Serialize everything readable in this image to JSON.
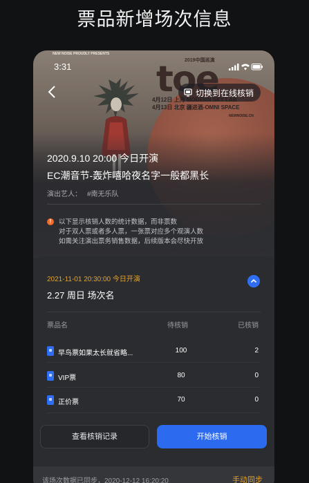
{
  "headline": "票品新增场次信息",
  "status_bar": {
    "time": "3:31"
  },
  "poster": {
    "top_text": "NEW NOISE PROUDLY PRESENTS",
    "logo": "toe",
    "year_text": "2019中国巡演",
    "lines": [
      "4月12日 上海 MODERN SKY LAB",
      "4月13日 北京 疆进酒-OMNI SPACE"
    ],
    "site": "NEWNOISE.CN"
  },
  "header": {
    "back_icon": "chevron-left-icon",
    "switch_label": "切换到在线核销",
    "switch_icon": "monitor-icon"
  },
  "event": {
    "date_line": "2020.9.10 20:00 今日开演",
    "title": "EC潮音节-轰炸嘻哈夜名字一般都黑长",
    "artist_label": "演出艺人：",
    "artist_value": "#南无乐队"
  },
  "notice": {
    "icon": "exclamation-icon",
    "lines": [
      "以下显示核销人数的统计数据，而非票数",
      "对于双人票或者多人票，一张票对应多个观演人数",
      "如需关注演出票务销售数据，后续版本会尽快开放"
    ]
  },
  "session": {
    "date_line": "2021-11-01 20:30:00 今日开演",
    "title": "2.27 周日 场次名",
    "collapse_icon": "chevron-up-icon",
    "columns": [
      "票品名",
      "待核销",
      "已核销"
    ],
    "rows": [
      {
        "name": "早鸟票如果太长就省略...",
        "pending": "100",
        "done": "2"
      },
      {
        "name": "VIP票",
        "pending": "80",
        "done": "0"
      },
      {
        "name": "正价票",
        "pending": "70",
        "done": "0"
      }
    ],
    "records_button": "查看核销记录",
    "start_button": "开始核销"
  },
  "sync": {
    "text": "该场次数据已同步，2020-12-12 16:20:20",
    "button": "手动同步"
  },
  "colors": {
    "accent_blue": "#2c6bf0",
    "accent_orange": "#e4a22a",
    "warning": "#ef6a2c"
  }
}
